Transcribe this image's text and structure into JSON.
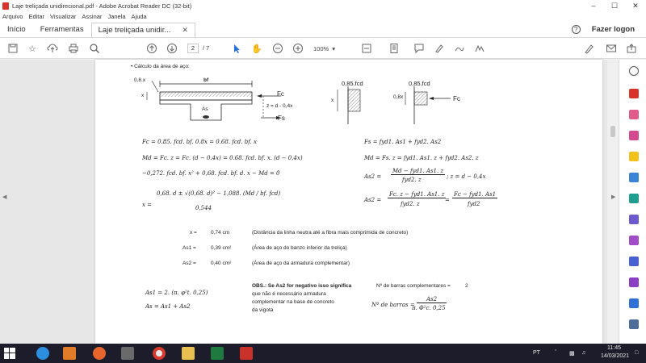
{
  "window": {
    "title": "Laje treliçada unidirecional.pdf - Adobe Acrobat Reader DC (32-bit)"
  },
  "menu": [
    "Arquivo",
    "Editar",
    "Visualizar",
    "Assinar",
    "Janela",
    "Ajuda"
  ],
  "tabs": {
    "home": "Início",
    "tools": "Ferramentas",
    "document": "Laje treliçada unidir...",
    "login": "Fazer logon"
  },
  "toolbar": {
    "page_current": "2",
    "page_total": "/ 7",
    "zoom": "100%"
  },
  "document": {
    "bullet": "• Cálculo da área de aço:",
    "fig1": {
      "top_left": "0,8.x",
      "bf": "bf",
      "x": "x",
      "As": "As",
      "Fc": "Fc",
      "z": "z = d - 0,4x",
      "Fs": "Fs"
    },
    "fig2": {
      "x": "x",
      "fcd": "0,85.fcd"
    },
    "fig3": {
      "x": "0,8x",
      "fcd": "0,85.fcd",
      "Fc": "Fc"
    },
    "eqs_left": [
      "Fc = 0.85. fcd. bf. 0.8x = 0.68. fcd. bf. x",
      "Md = Fc. z = Fc. (d − 0.4x) = 0.68. fcd. bf. x. (d − 0,4x)",
      "−0,272. fcd. bf. x² + 0,68. fcd. bf. d. x − Md = 0",
      "x =",
      "0,68. d ± √(0,68. d)² − 1,088. (Md / bf. fcd)",
      "0,544"
    ],
    "eqs_right": [
      "Fs = fyd1. As1 + fyd2. As2",
      "Md = Fs. z = fyd1. As1. z + fyd2. As2. z",
      "As2 =",
      "Md − fyd1. As1. z",
      "fyd2. z",
      ";  z = d − 0,4x",
      "As2 =",
      "Fc. z − fyd1. As1. z",
      "fyd2. z",
      "=",
      "Fc − fyd1. As1",
      "fyd2"
    ],
    "results": [
      {
        "name": "x =",
        "value": "0,74 cm",
        "desc": "(Distância da linha neutra até a fibra mais comprimida de concreto)"
      },
      {
        "name": "As1 =",
        "value": "0,39 cm²",
        "desc": "(Área de aço do banzo inferior da treliça)"
      },
      {
        "name": "As2 =",
        "value": "0,40 cm²",
        "desc": "(Área de aço da armadura complementar)"
      }
    ],
    "as1_formula": "As1 = 2. (π. φ²t. 0,25)",
    "as_formula": "As = As1 + As2",
    "obs": [
      "OBS.: Se As2 for negativo isso significa",
      "que não é necessário armadura",
      "complementar na base de concreto",
      "da vigota"
    ],
    "nbars_label": "Nº de barras complementares =",
    "nbars_value": "2",
    "nbars_formula_lhs": "Nº de barras =",
    "nbars_formula_num": "As2",
    "nbars_formula_den": "π. Φ²c. 0,25"
  },
  "taskbar": {
    "lang": "PT",
    "time": "11:45",
    "date": "14/03/2021"
  },
  "colors": {
    "pdf_red": "#d9342b",
    "taskbar": "#1c1c2a",
    "acrobat_blue": "#2b6fd8"
  }
}
